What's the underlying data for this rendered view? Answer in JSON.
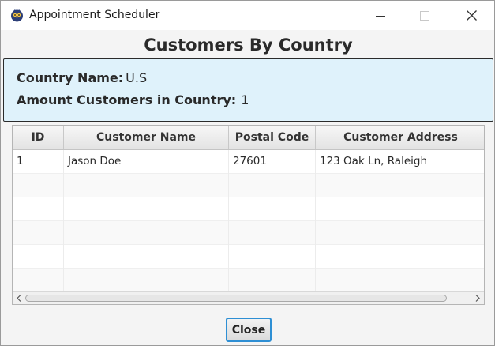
{
  "window": {
    "title": "Appointment Scheduler",
    "icon": "app-logo-icon",
    "controls": [
      "minimize-icon",
      "maximize-icon",
      "close-icon"
    ]
  },
  "heading": "Customers By Country",
  "info": {
    "country_label": "Country Name:",
    "country_value": "U.S",
    "amount_label": "Amount Customers in Country:",
    "amount_value": "1"
  },
  "table": {
    "columns": [
      "ID",
      "Customer Name",
      "Postal Code",
      "Customer Address"
    ],
    "rows": [
      [
        "1",
        "Jason Doe",
        "27601",
        "123 Oak Ln, Raleigh"
      ]
    ]
  },
  "buttons": {
    "close_label": "Close"
  },
  "colors": {
    "info_panel_bg": "#dff2fb",
    "focus_border": "#2e8fd4"
  }
}
